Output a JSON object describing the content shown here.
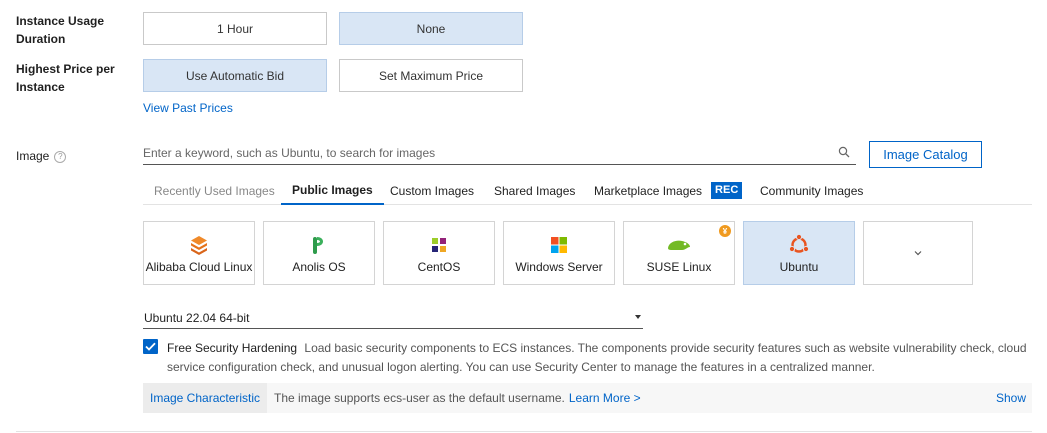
{
  "usage": {
    "label": "Instance Usage Duration",
    "options": [
      "1 Hour",
      "None"
    ],
    "selected": "None"
  },
  "price": {
    "label": "Highest Price per Instance",
    "options": [
      "Use Automatic Bid",
      "Set Maximum Price"
    ],
    "selected": "Use Automatic Bid",
    "view_past_prices": "View Past Prices"
  },
  "image": {
    "label": "Image",
    "help_icon": "question-circle-icon",
    "search_placeholder": "Enter a keyword, such as Ubuntu, to search for images",
    "search_value": "",
    "catalog_button": "Image Catalog",
    "tabs": [
      {
        "label": "Recently Used Images"
      },
      {
        "label": "Public Images"
      },
      {
        "label": "Custom Images"
      },
      {
        "label": "Shared Images"
      },
      {
        "label": "Marketplace Images",
        "badge": "REC"
      },
      {
        "label": "Community Images"
      }
    ],
    "active_tab": "Public Images",
    "os_cards": [
      {
        "name": "Alibaba Cloud Linux",
        "icon": "alibaba-cloud-linux-icon"
      },
      {
        "name": "Anolis OS",
        "icon": "anolis-os-icon"
      },
      {
        "name": "CentOS",
        "icon": "centos-icon"
      },
      {
        "name": "Windows Server",
        "icon": "windows-icon"
      },
      {
        "name": "SUSE Linux",
        "icon": "suse-icon",
        "badge": "¥"
      },
      {
        "name": "Ubuntu",
        "icon": "ubuntu-icon"
      },
      {
        "name": "",
        "icon": "chevron-down-icon"
      }
    ],
    "selected_os": "Ubuntu",
    "version": "Ubuntu 22.04 64-bit",
    "security": {
      "checked": true,
      "title": "Free Security Hardening",
      "description": "Load basic security components to ECS instances. The components provide security features such as website vulnerability check, cloud service configuration check, and unusual logon alerting. You can use Security Center to manage the features in a centralized manner."
    },
    "characteristic": {
      "label": "Image Characteristic",
      "description": "The image supports ecs-user as the default username.",
      "learn_more": "Learn More >",
      "show": "Show"
    }
  },
  "colors": {
    "accent": "#0064c8",
    "selected_bg": "#d9e6f5",
    "rec_badge": "#0064c8",
    "price_badge": "#f09a1f"
  }
}
